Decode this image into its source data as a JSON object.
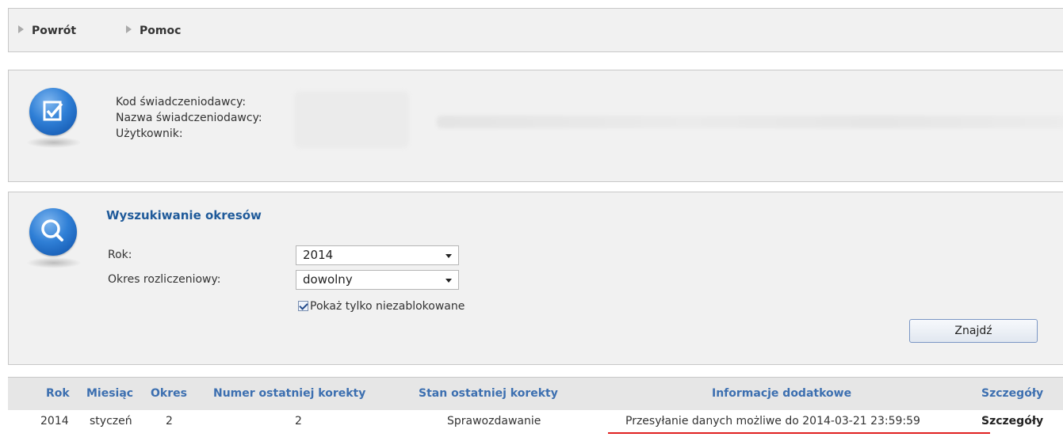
{
  "nav": {
    "back_label": "Powrót",
    "help_label": "Pomoc"
  },
  "info": {
    "provider_code_label": "Kod świadczeniodawcy:",
    "provider_name_label": "Nazwa świadczeniodawcy:",
    "user_label": "Użytkownik:"
  },
  "search": {
    "title": "Wyszukiwanie okresów",
    "year_label": "Rok:",
    "year_value": "2014",
    "period_label": "Okres rozliczeniowy:",
    "period_value": "dowolny",
    "checkbox_label": "Pokaż tylko niezablokowane",
    "checkbox_checked": true,
    "find_button": "Znajdź"
  },
  "table": {
    "headers": [
      "Rok",
      "Miesiąc",
      "Okres",
      "Numer ostatniej korekty",
      "Stan ostatniej korekty",
      "Informacje dodatkowe",
      "Szczegóły"
    ],
    "rows": [
      [
        "2014",
        "styczeń",
        "2",
        "2",
        "Sprawozdawanie",
        "Przesyłanie danych możliwe do 2014-03-21 23:59:59",
        "Szczegóły"
      ]
    ]
  },
  "colors": {
    "header_link": "#3c6fb0",
    "search_title": "#1f5a9a",
    "underline": "#e02020"
  }
}
